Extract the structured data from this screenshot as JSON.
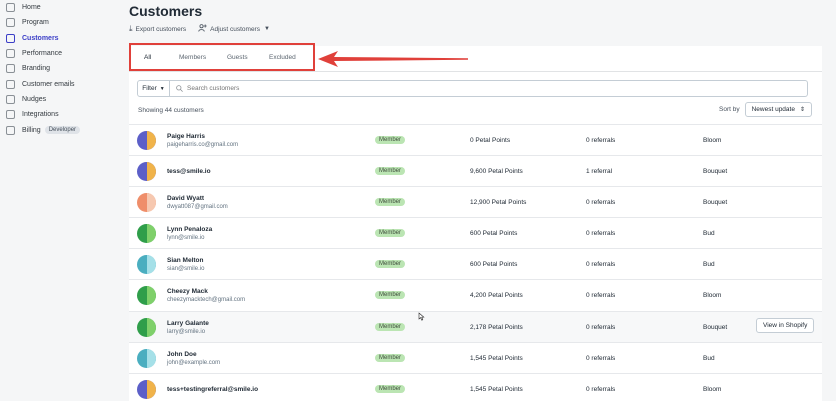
{
  "sidebar": {
    "items": [
      {
        "label": "Home",
        "icon": "home-icon"
      },
      {
        "label": "Program",
        "icon": "gift-icon"
      },
      {
        "label": "Customers",
        "icon": "customers-icon",
        "active": true
      },
      {
        "label": "Performance",
        "icon": "chart-icon"
      },
      {
        "label": "Branding",
        "icon": "paintbrush-icon"
      },
      {
        "label": "Customer emails",
        "icon": "envelope-icon"
      },
      {
        "label": "Nudges",
        "icon": "nudge-icon"
      },
      {
        "label": "Integrations",
        "icon": "grid-icon"
      },
      {
        "label": "Billing",
        "icon": "billing-icon",
        "badge": "Developer"
      }
    ]
  },
  "header": {
    "title": "Customers",
    "export_label": "Export customers",
    "adjust_label": "Adjust customers"
  },
  "tabs": [
    {
      "label": "All",
      "active": true
    },
    {
      "label": "Members"
    },
    {
      "label": "Guests"
    },
    {
      "label": "Excluded"
    }
  ],
  "filter": {
    "label": "Filter",
    "search_placeholder": "Search customers"
  },
  "list": {
    "showing": "Showing 44 customers",
    "sort_label": "Sort by",
    "sort_value": "Newest update"
  },
  "customers": [
    {
      "name": "Paige Harris",
      "email": "paigeharris.co@gmail.com",
      "status": "Member",
      "points": "0 Petal Points",
      "referrals": "0 referrals",
      "tier": "Bloom",
      "colors": [
        "#5c5fc8",
        "#f0b34a"
      ]
    },
    {
      "name": "tess@smile.io",
      "email": "",
      "status": "Member",
      "points": "9,600 Petal Points",
      "referrals": "1 referral",
      "tier": "Bouquet",
      "colors": [
        "#5c5fc8",
        "#f0b34a"
      ]
    },
    {
      "name": "David Wyatt",
      "email": "dwyatt087@gmail.com",
      "status": "Member",
      "points": "12,900 Petal Points",
      "referrals": "0 referrals",
      "tier": "Bouquet",
      "colors": [
        "#ef8e6a",
        "#f6c8b0"
      ]
    },
    {
      "name": "Lynn Penaloza",
      "email": "lynn@smile.io",
      "status": "Member",
      "points": "600 Petal Points",
      "referrals": "0 referrals",
      "tier": "Bud",
      "colors": [
        "#2f9e4a",
        "#7fd06a"
      ]
    },
    {
      "name": "Sian Melton",
      "email": "sian@smile.io",
      "status": "Member",
      "points": "600 Petal Points",
      "referrals": "0 referrals",
      "tier": "Bud",
      "colors": [
        "#4aaec0",
        "#a5e0e8"
      ]
    },
    {
      "name": "Cheezy Mack",
      "email": "cheezymacktech@gmail.com",
      "status": "Member",
      "points": "4,200 Petal Points",
      "referrals": "0 referrals",
      "tier": "Bloom",
      "colors": [
        "#2f9e4a",
        "#7fd06a"
      ]
    },
    {
      "name": "Larry Galante",
      "email": "larry@smile.io",
      "status": "Member",
      "points": "2,178 Petal Points",
      "referrals": "0 referrals",
      "tier": "Bouquet",
      "colors": [
        "#2f9e4a",
        "#7fd06a"
      ],
      "view_button": "View in Shopify"
    },
    {
      "name": "John Doe",
      "email": "john@example.com",
      "status": "Member",
      "points": "1,545 Petal Points",
      "referrals": "0 referrals",
      "tier": "Bud",
      "colors": [
        "#4aaec0",
        "#a5e0e8"
      ]
    },
    {
      "name": "tess+testingreferral@smile.io",
      "email": "",
      "status": "Member",
      "points": "1,545 Petal Points",
      "referrals": "0 referrals",
      "tier": "Bloom",
      "colors": [
        "#5c5fc8",
        "#f0b34a"
      ]
    }
  ]
}
